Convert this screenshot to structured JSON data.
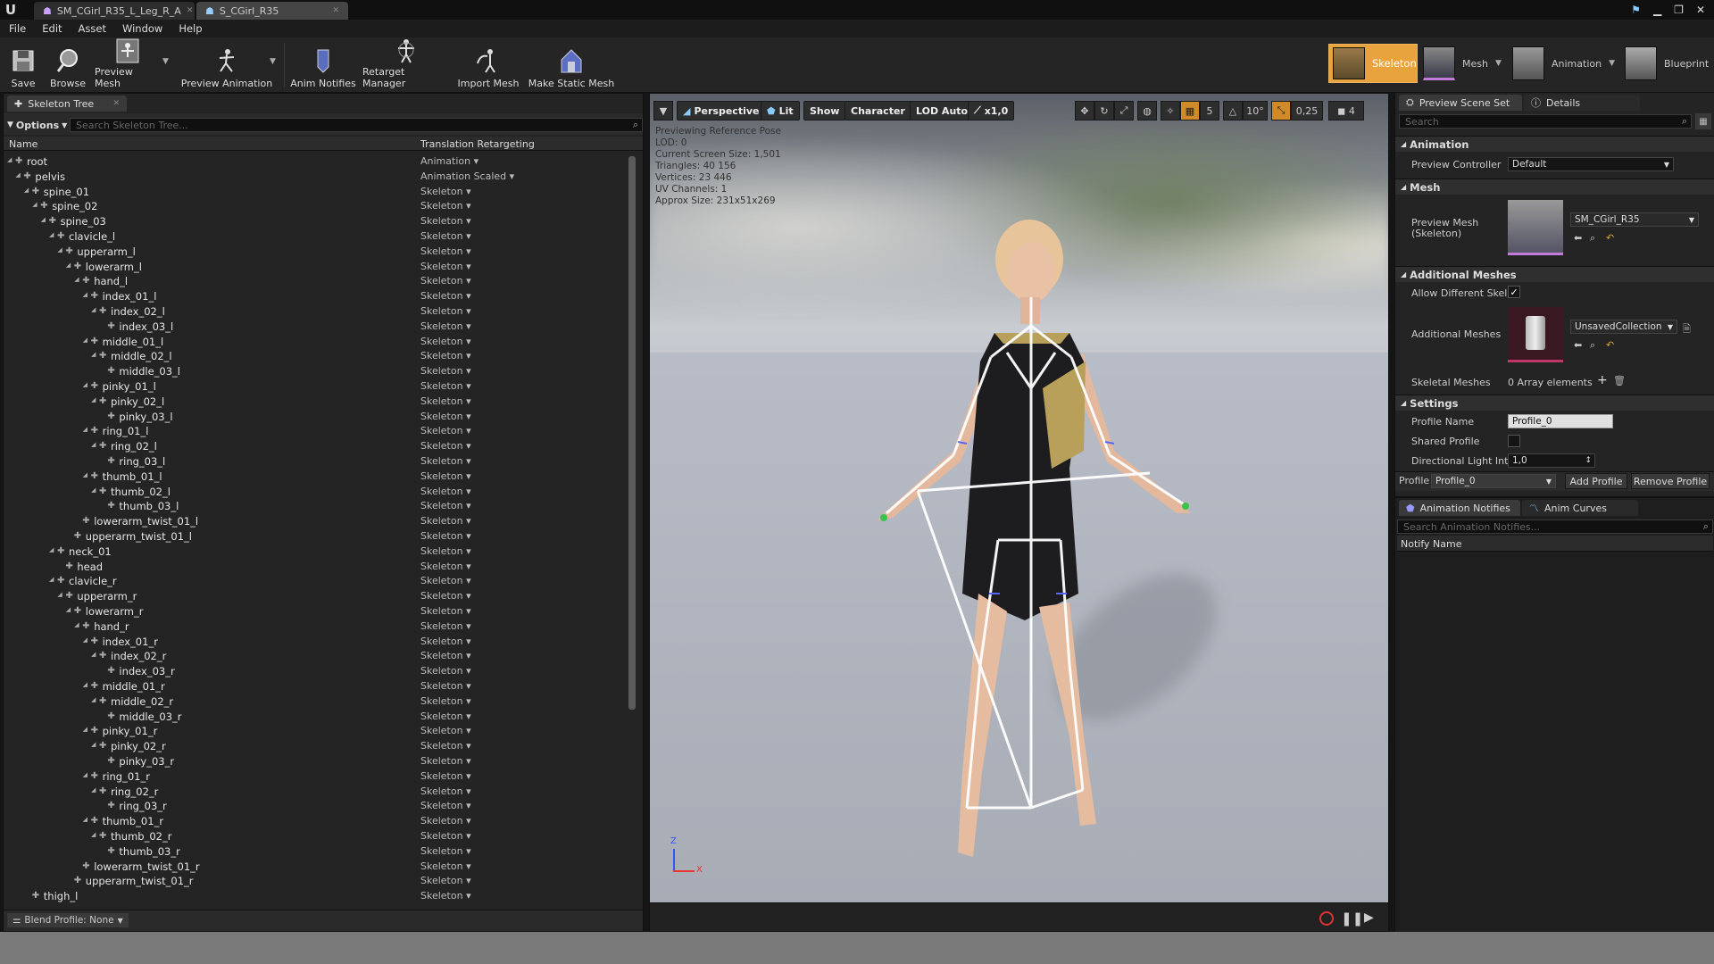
{
  "titlebar": {
    "tabs": [
      {
        "label": "SM_CGirl_R35_L_Leg_R_A"
      },
      {
        "label": "S_CGirl_R35"
      }
    ]
  },
  "menu": [
    "File",
    "Edit",
    "Asset",
    "Window",
    "Help"
  ],
  "toolbar": {
    "save": "Save",
    "browse": "Browse",
    "preview_mesh": "Preview Mesh",
    "preview_animation": "Preview Animation",
    "anim_notifies": "Anim Notifies",
    "retarget_manager": "Retarget Manager",
    "import_mesh": "Import Mesh",
    "make_static_mesh": "Make Static Mesh"
  },
  "modes": {
    "skeleton": "Skeleton",
    "mesh": "Mesh",
    "animation": "Animation",
    "blueprint": "Blueprint"
  },
  "skeleton_tree": {
    "tab_label": "Skeleton Tree",
    "options_label": "Options",
    "search_placeholder": "Search Skeleton Tree...",
    "col_name": "Name",
    "col_retarget": "Translation Retargeting",
    "blend_profile": "Blend Profile: None",
    "rows": [
      {
        "name": "root",
        "retarget": "Animation"
      },
      {
        "name": "pelvis",
        "retarget": "Animation Scaled"
      },
      {
        "name": "spine_01",
        "retarget": "Skeleton"
      },
      {
        "name": "spine_02",
        "retarget": "Skeleton"
      },
      {
        "name": "spine_03",
        "retarget": "Skeleton"
      },
      {
        "name": "clavicle_l",
        "retarget": "Skeleton"
      },
      {
        "name": "upperarm_l",
        "retarget": "Skeleton"
      },
      {
        "name": "lowerarm_l",
        "retarget": "Skeleton"
      },
      {
        "name": "hand_l",
        "retarget": "Skeleton"
      },
      {
        "name": "index_01_l",
        "retarget": "Skeleton"
      },
      {
        "name": "index_02_l",
        "retarget": "Skeleton"
      },
      {
        "name": "index_03_l",
        "retarget": "Skeleton"
      },
      {
        "name": "middle_01_l",
        "retarget": "Skeleton"
      },
      {
        "name": "middle_02_l",
        "retarget": "Skeleton"
      },
      {
        "name": "middle_03_l",
        "retarget": "Skeleton"
      },
      {
        "name": "pinky_01_l",
        "retarget": "Skeleton"
      },
      {
        "name": "pinky_02_l",
        "retarget": "Skeleton"
      },
      {
        "name": "pinky_03_l",
        "retarget": "Skeleton"
      },
      {
        "name": "ring_01_l",
        "retarget": "Skeleton"
      },
      {
        "name": "ring_02_l",
        "retarget": "Skeleton"
      },
      {
        "name": "ring_03_l",
        "retarget": "Skeleton"
      },
      {
        "name": "thumb_01_l",
        "retarget": "Skeleton"
      },
      {
        "name": "thumb_02_l",
        "retarget": "Skeleton"
      },
      {
        "name": "thumb_03_l",
        "retarget": "Skeleton"
      },
      {
        "name": "lowerarm_twist_01_l",
        "retarget": "Skeleton"
      },
      {
        "name": "upperarm_twist_01_l",
        "retarget": "Skeleton"
      },
      {
        "name": "neck_01",
        "retarget": "Skeleton"
      },
      {
        "name": "head",
        "retarget": "Skeleton"
      },
      {
        "name": "clavicle_r",
        "retarget": "Skeleton"
      },
      {
        "name": "upperarm_r",
        "retarget": "Skeleton"
      },
      {
        "name": "lowerarm_r",
        "retarget": "Skeleton"
      },
      {
        "name": "hand_r",
        "retarget": "Skeleton"
      },
      {
        "name": "index_01_r",
        "retarget": "Skeleton"
      },
      {
        "name": "index_02_r",
        "retarget": "Skeleton"
      },
      {
        "name": "index_03_r",
        "retarget": "Skeleton"
      },
      {
        "name": "middle_01_r",
        "retarget": "Skeleton"
      },
      {
        "name": "middle_02_r",
        "retarget": "Skeleton"
      },
      {
        "name": "middle_03_r",
        "retarget": "Skeleton"
      },
      {
        "name": "pinky_01_r",
        "retarget": "Skeleton"
      },
      {
        "name": "pinky_02_r",
        "retarget": "Skeleton"
      },
      {
        "name": "pinky_03_r",
        "retarget": "Skeleton"
      },
      {
        "name": "ring_01_r",
        "retarget": "Skeleton"
      },
      {
        "name": "ring_02_r",
        "retarget": "Skeleton"
      },
      {
        "name": "ring_03_r",
        "retarget": "Skeleton"
      },
      {
        "name": "thumb_01_r",
        "retarget": "Skeleton"
      },
      {
        "name": "thumb_02_r",
        "retarget": "Skeleton"
      },
      {
        "name": "thumb_03_r",
        "retarget": "Skeleton"
      },
      {
        "name": "lowerarm_twist_01_r",
        "retarget": "Skeleton"
      },
      {
        "name": "upperarm_twist_01_r",
        "retarget": "Skeleton"
      },
      {
        "name": "thigh_l",
        "retarget": "Skeleton"
      }
    ]
  },
  "viewport": {
    "perspective": "Perspective",
    "lit": "Lit",
    "show": "Show",
    "character": "Character",
    "lod": "LOD Auto",
    "speed": "x1,0",
    "grid_snap": "5",
    "rot_snap": "10°",
    "scale_snap": "0,25",
    "cam_speed": "4",
    "stats": [
      "Previewing Reference Pose",
      "LOD: 0",
      "Current Screen Size: 1,501",
      "Triangles: 40 156",
      "Vertices: 23 446",
      "UV Channels: 1",
      "Approx Size: 231x51x269"
    ],
    "axis_z": "Z",
    "axis_x": "X"
  },
  "details": {
    "tab_scene": "Preview Scene Set",
    "tab_details": "Details",
    "search_placeholder": "Search",
    "sec_animation": "Animation",
    "preview_controller_label": "Preview Controller",
    "preview_controller_value": "Default",
    "sec_mesh": "Mesh",
    "preview_mesh_label": "Preview Mesh (Skeleton)",
    "preview_mesh_value": "SM_CGirl_R35",
    "sec_additional": "Additional Meshes",
    "allow_different_label": "Allow Different Skele",
    "additional_meshes_label": "Additional Meshes",
    "additional_meshes_value": "UnsavedCollection",
    "skeletal_meshes_label": "Skeletal Meshes",
    "skeletal_meshes_value": "0 Array elements",
    "sec_settings": "Settings",
    "profile_name_label": "Profile Name",
    "profile_name_value": "Profile_0",
    "shared_profile_label": "Shared Profile",
    "directional_light_label": "Directional Light Inte",
    "directional_light_value": "1,0",
    "profile_label": "Profile",
    "profile_value": "Profile_0",
    "add_profile": "Add Profile",
    "remove_profile": "Remove Profile"
  },
  "notifies": {
    "tab_notifies": "Animation Notifies",
    "tab_curves": "Anim Curves",
    "search_placeholder": "Search Animation Notifies...",
    "col_notify": "Notify Name"
  },
  "colors": {
    "accent": "#e8a33c",
    "panel": "#242424",
    "header": "#2f2f2f"
  }
}
